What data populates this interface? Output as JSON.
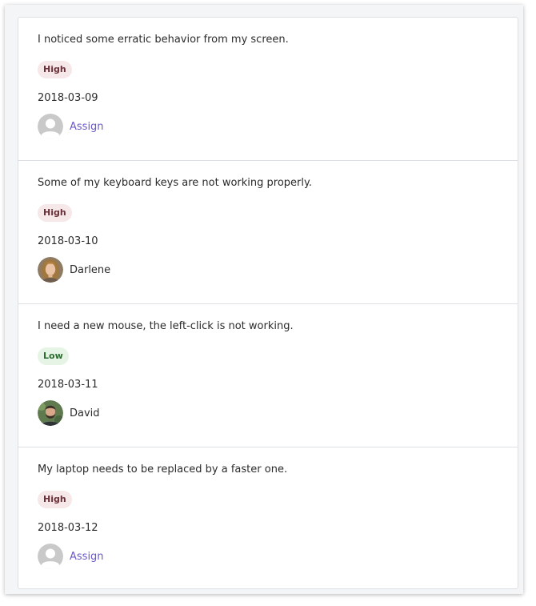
{
  "tickets": [
    {
      "description": "I noticed some erratic behavior from my screen.",
      "priority": "High",
      "priority_level": "high",
      "date": "2018-03-09",
      "assignee": null,
      "assign_label": "Assign",
      "avatar": "placeholder-user-icon"
    },
    {
      "description": "Some of my keyboard keys are not working properly.",
      "priority": "High",
      "priority_level": "high",
      "date": "2018-03-10",
      "assignee": "Darlene",
      "assign_label": null,
      "avatar": "darlene-avatar"
    },
    {
      "description": "I need a new mouse, the left-click is not working.",
      "priority": "Low",
      "priority_level": "low",
      "date": "2018-03-11",
      "assignee": "David",
      "assign_label": null,
      "avatar": "david-avatar"
    },
    {
      "description": "My laptop needs to be replaced by a faster one.",
      "priority": "High",
      "priority_level": "high",
      "date": "2018-03-12",
      "assignee": null,
      "assign_label": "Assign",
      "avatar": "placeholder-user-icon"
    }
  ],
  "colors": {
    "high_badge_bg": "#f6e8e9",
    "high_badge_text": "#6a3038",
    "low_badge_bg": "#e6f4e6",
    "low_badge_text": "#2f6b31",
    "assign_link": "#6b58c7"
  }
}
